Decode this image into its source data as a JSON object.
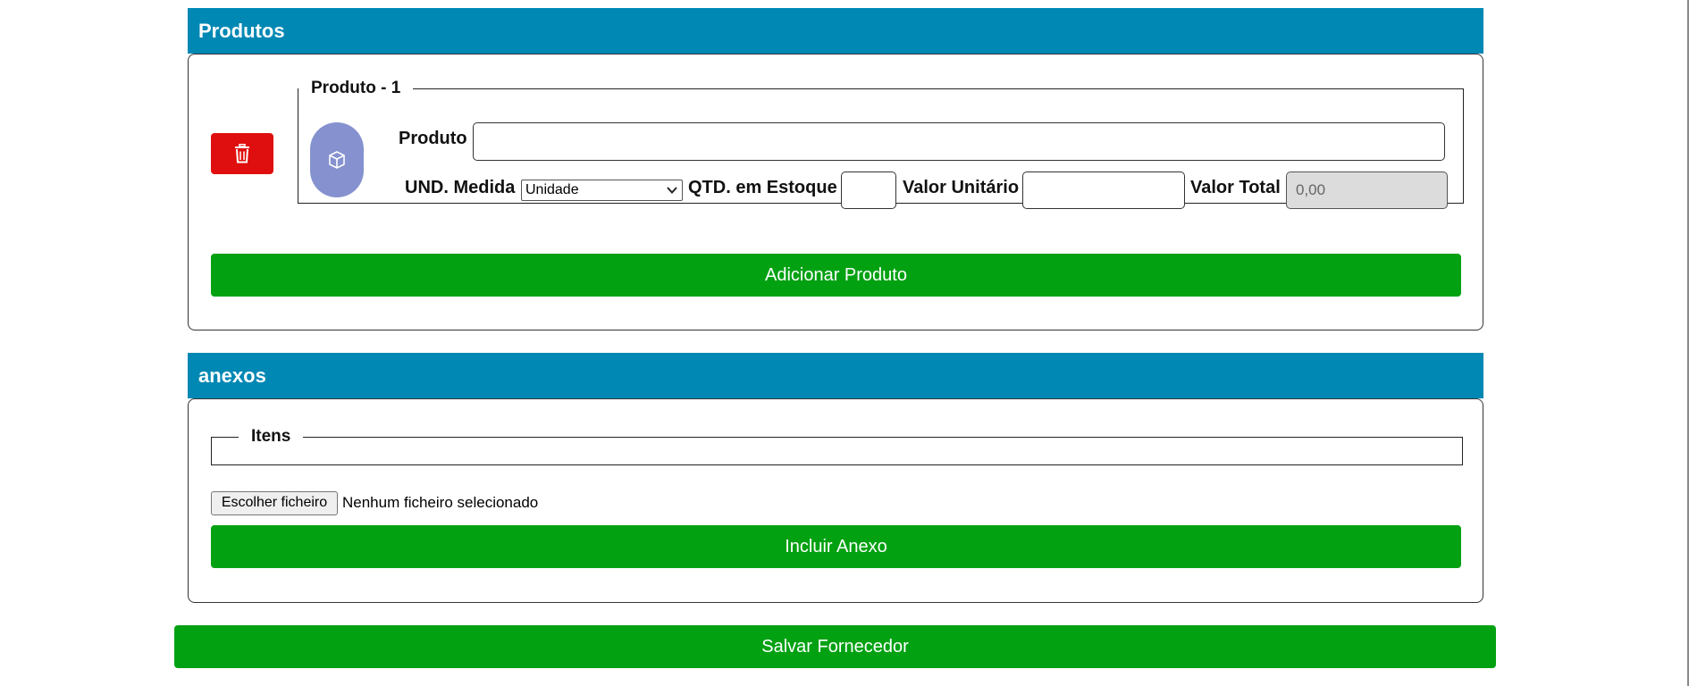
{
  "produtos": {
    "header_title": "Produtos",
    "item": {
      "legend": "Produto - 1",
      "produto_label": "Produto",
      "produto_value": "",
      "und_label": "UND. Medida",
      "und_selected": "Unidade",
      "qtd_label": "QTD. em Estoque",
      "qtd_value": "",
      "valor_unitario_label": "Valor Unitário",
      "valor_unitario_value": "",
      "valor_total_label": "Valor Total",
      "valor_total_value": "0,00"
    },
    "add_button_label": "Adicionar Produto"
  },
  "anexos": {
    "header_title": "anexos",
    "itens_legend": "Itens",
    "file_button_label": "Escolher ficheiro",
    "file_status": "Nenhum ficheiro selecionado",
    "include_button_label": "Incluir Anexo"
  },
  "save_button_label": "Salvar Fornecedor",
  "colors": {
    "header_bg": "#0088b4",
    "primary_green": "#02a112",
    "danger_red": "#e00f0f",
    "box_button": "#8592cf"
  },
  "icons": {
    "delete": "trash-icon",
    "product": "box-icon",
    "select": "chevron-down-icon"
  }
}
